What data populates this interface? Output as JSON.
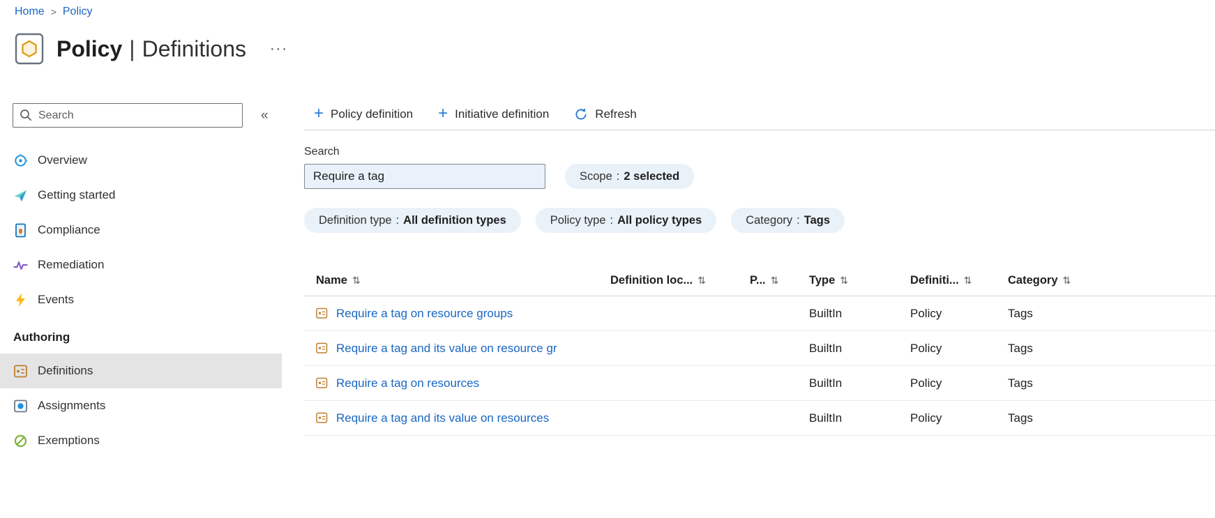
{
  "colors": {
    "accent": "#2b7cd3",
    "link": "#1a66c2",
    "pill-bg": "#e9f1f9",
    "selected-bg": "#e4e4e4"
  },
  "icons": {
    "plus": "+",
    "collapse": "«",
    "more": "···",
    "sort": "⇅",
    "pill_separator": ":",
    "breadcrumb_separator": ">"
  },
  "breadcrumb": {
    "items": [
      "Home",
      "Policy"
    ]
  },
  "header": {
    "title_primary": "Policy",
    "title_separator": "|",
    "title_secondary": "Definitions"
  },
  "sidebar": {
    "search_placeholder": "Search",
    "section_label": "Authoring",
    "items": [
      {
        "label": "Overview"
      },
      {
        "label": "Getting started"
      },
      {
        "label": "Compliance"
      },
      {
        "label": "Remediation"
      },
      {
        "label": "Events"
      }
    ],
    "authoring_items": [
      {
        "label": "Definitions",
        "selected": true
      },
      {
        "label": "Assignments",
        "selected": false
      },
      {
        "label": "Exemptions",
        "selected": false
      }
    ]
  },
  "toolbar": {
    "policy_definition_label": "Policy definition",
    "initiative_definition_label": "Initiative definition",
    "refresh_label": "Refresh"
  },
  "filters": {
    "search_label": "Search",
    "search_value": "Require a tag",
    "pills": [
      {
        "name": "Scope",
        "value": "2 selected"
      },
      {
        "name": "Definition type",
        "value": "All definition types"
      },
      {
        "name": "Policy type",
        "value": "All policy types"
      },
      {
        "name": "Category",
        "value": "Tags"
      }
    ]
  },
  "table": {
    "columns": [
      "Name",
      "Definition loc...",
      "P...",
      "Type",
      "Definiti...",
      "Category"
    ],
    "rows": [
      {
        "name": "Require a tag on resource groups",
        "type": "BuiltIn",
        "definition_type": "Policy",
        "category": "Tags"
      },
      {
        "name": "Require a tag and its value on resource gr",
        "type": "BuiltIn",
        "definition_type": "Policy",
        "category": "Tags"
      },
      {
        "name": "Require a tag on resources",
        "type": "BuiltIn",
        "definition_type": "Policy",
        "category": "Tags"
      },
      {
        "name": "Require a tag and its value on resources",
        "type": "BuiltIn",
        "definition_type": "Policy",
        "category": "Tags"
      }
    ]
  }
}
